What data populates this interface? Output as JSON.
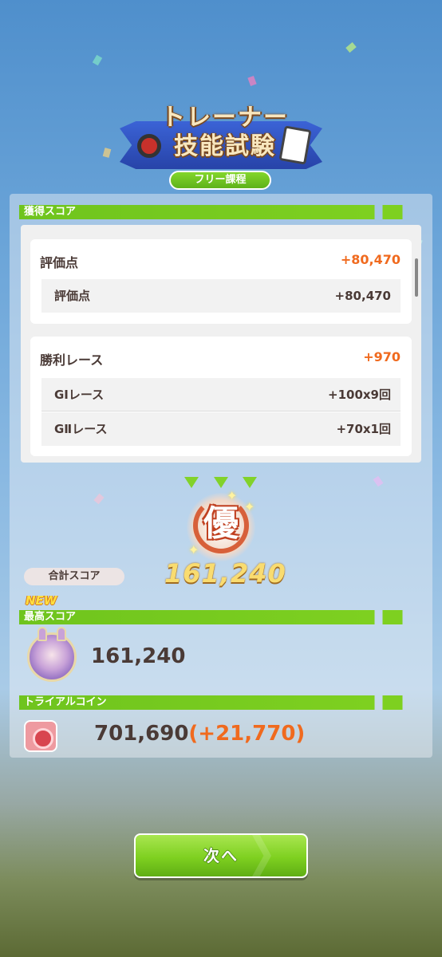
{
  "header": {
    "title_line1": "トレーナー",
    "title_line2": "技能試験",
    "course": "フリー課程"
  },
  "score_section": {
    "label": "獲得スコア",
    "cards": [
      {
        "title": "評価点",
        "value": "+80,470",
        "rows": [
          {
            "label": "評価点",
            "value": "+80,470"
          }
        ]
      },
      {
        "title": "勝利レース",
        "value": "+970",
        "rows": [
          {
            "label": "GⅠレース",
            "value": "+100x9回"
          },
          {
            "label": "GⅡレース",
            "value": "+70x1回"
          }
        ]
      }
    ]
  },
  "result": {
    "rank": "優",
    "total_label": "合計スコア",
    "total_value": "161,240"
  },
  "best": {
    "new_badge": "NEW",
    "label": "最高スコア",
    "value": "161,240"
  },
  "coins": {
    "label": "トライアルコイン",
    "value": "701,690",
    "delta": "(+21,770)"
  },
  "next_button": {
    "label": "次へ"
  },
  "colors": {
    "accent_green": "#7ed020",
    "score_orange": "#f06a1e",
    "text_brown": "#4a3a36",
    "ribbon_blue": "#2f52c0"
  }
}
